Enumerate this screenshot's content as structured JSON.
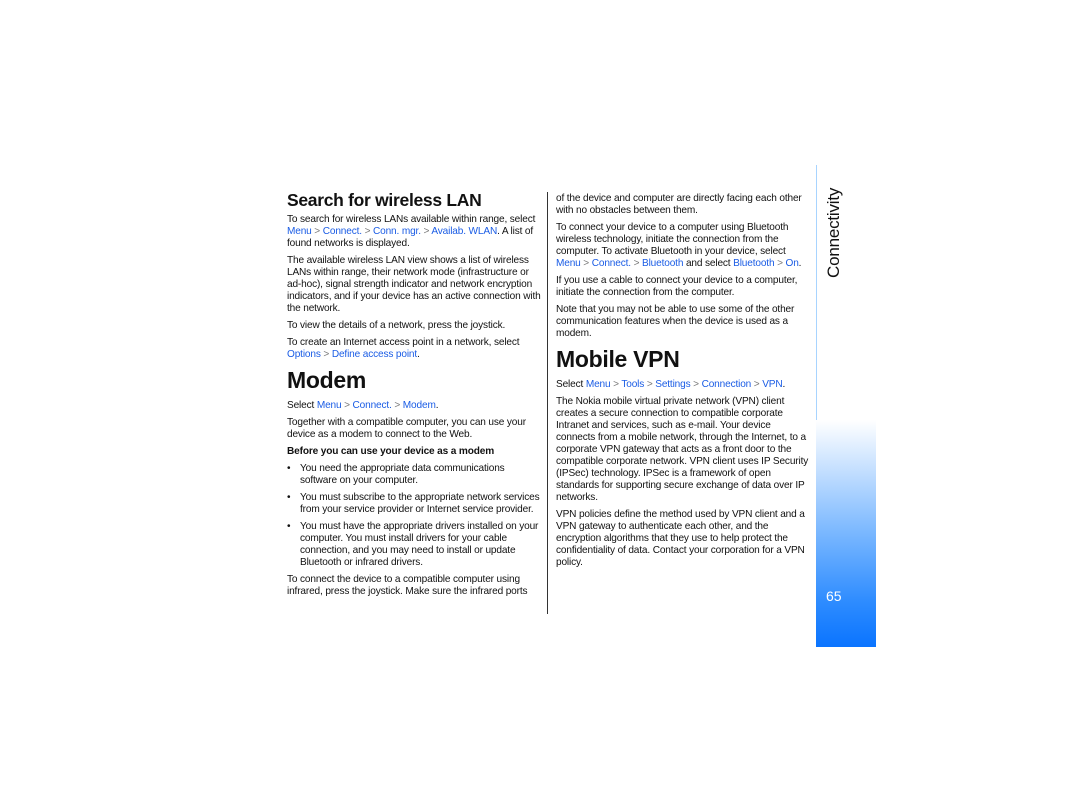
{
  "sidebar": {
    "section_tab": "Connectivity",
    "page_number": "65",
    "accent_color": "#0a74ff"
  },
  "search_wlan": {
    "title": "Search for wireless LAN",
    "p1_a": "To search for wireless LANs available within range, select ",
    "p1_path": [
      "Menu",
      "Connect.",
      "Conn. mgr.",
      "Availab. WLAN"
    ],
    "p1_b": ". A list of found networks is displayed.",
    "p2": "The available wireless LAN view shows a list of wireless LANs within range, their network mode (infrastructure or ad-hoc), signal strength indicator and network encryption indicators, and if your device has an active connection with the network.",
    "p3": "To view the details of a network, press the joystick.",
    "p4_a": "To create an Internet access point in a network, select ",
    "p4_path": [
      "Options",
      "Define access point"
    ],
    "p4_b": "."
  },
  "modem": {
    "title": "Modem",
    "select_a": "Select ",
    "select_path": [
      "Menu",
      "Connect.",
      "Modem"
    ],
    "select_b": ".",
    "p1": "Together with a compatible computer, you can use your device as a modem to connect to the Web.",
    "subhead": "Before you can use your device as a modem",
    "bullets": [
      "You need the appropriate data communications software on your computer.",
      "You must subscribe to the appropriate network services from your service provider or Internet service provider.",
      "You must have the appropriate drivers installed on your computer. You must install drivers for your cable connection, and you may need to install or update Bluetooth or infrared drivers."
    ],
    "bullet_glyph": "•",
    "p2": "To connect the device to a compatible computer using infrared, press the joystick. Make sure the infrared ports",
    "p2_cont": "of the device and computer are directly facing each other with no obstacles between them.",
    "p3_a": "To connect your device to a computer using Bluetooth wireless technology, initiate the connection from the computer. To activate Bluetooth in your device, select ",
    "p3_path": [
      "Menu",
      "Connect.",
      "Bluetooth"
    ],
    "p3_mid": " and select ",
    "p3_path2": [
      "Bluetooth",
      "On"
    ],
    "p3_b": ".",
    "p4": "If you use a cable to connect your device to a computer, initiate the connection from the computer.",
    "p5": "Note that you may not be able to use some of the other communication features when the device is used as a modem."
  },
  "mobile_vpn": {
    "title": "Mobile VPN",
    "select_a": "Select ",
    "select_path": [
      "Menu",
      "Tools",
      "Settings",
      "Connection",
      "VPN"
    ],
    "select_b": ".",
    "p1": "The Nokia mobile virtual private network (VPN) client creates a secure connection to compatible corporate Intranet and services, such as e-mail. Your device connects from a mobile network, through the Internet, to a corporate VPN gateway that acts as a front door to the compatible corporate network. VPN client uses IP Security (IPSec) technology. IPSec is a framework of open standards for supporting secure exchange of data over IP networks.",
    "p2": "VPN policies define the method used by VPN client and a VPN gateway to authenticate each other, and the encryption algorithms that they use to help protect the confidentiality of data. Contact your corporation for a VPN policy."
  },
  "path_separator": " > "
}
